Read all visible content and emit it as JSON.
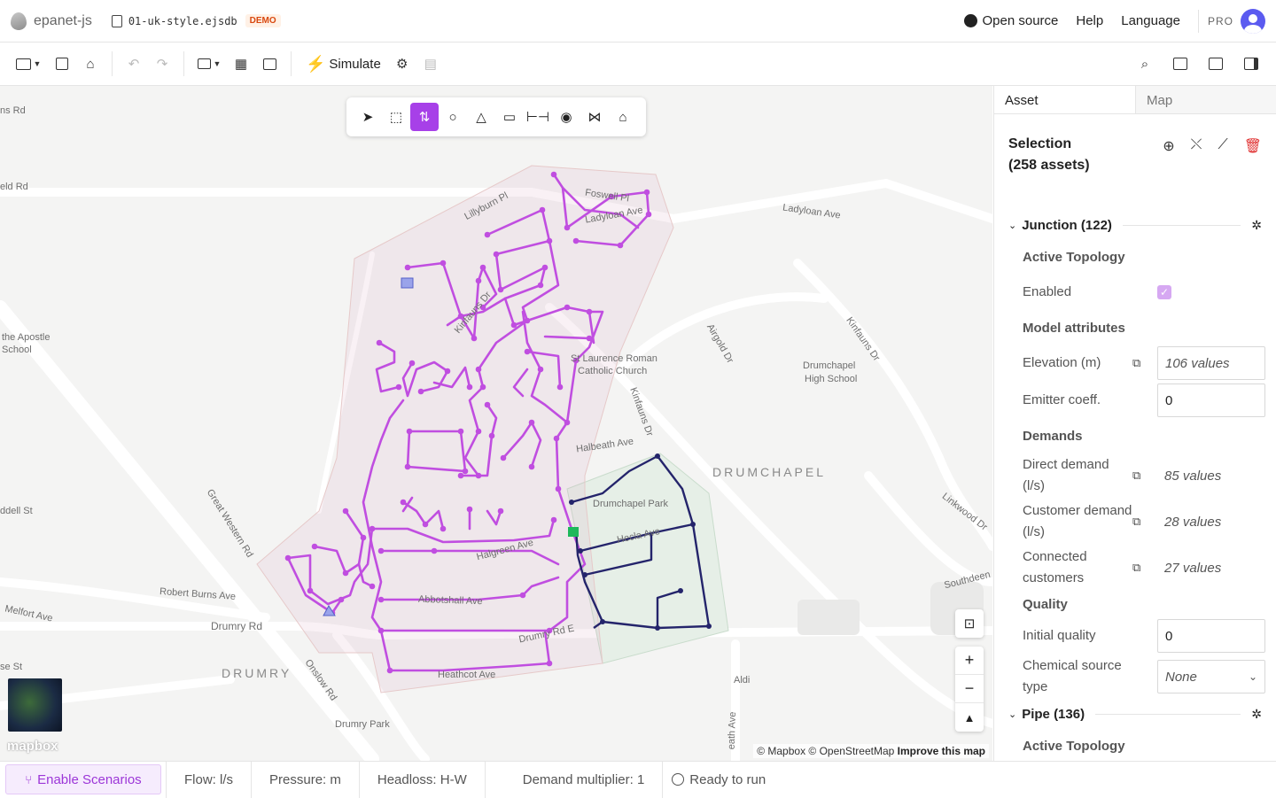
{
  "header": {
    "app_name": "epanet-js",
    "file_name": "01-uk-style.ejsdb",
    "demo_badge": "DEMO",
    "links": [
      "Open source",
      "Help",
      "Language"
    ],
    "pro_label": "PRO"
  },
  "toolbar": {
    "simulate_label": "Simulate",
    "icons": [
      "folder-icon",
      "save-icon",
      "save-as-icon",
      "undo-icon",
      "redo-icon",
      "import-icon",
      "table-icon",
      "map-view-icon",
      "simulate-icon",
      "settings-icon",
      "report-icon",
      "search-icon",
      "left-panel-icon",
      "bottom-panel-icon",
      "right-panel-icon"
    ]
  },
  "draw_tools": [
    "select-arrow-icon",
    "lasso-select-icon",
    "connect-tool-icon",
    "junction-tool-icon",
    "reservoir-tool-icon",
    "tank-tool-icon",
    "pipe-tool-icon",
    "pump-tool-icon",
    "valve-tool-icon",
    "customer-tool-icon"
  ],
  "map": {
    "labels": [
      "ns Rd",
      "eld Rd",
      "Lillyburn Pl",
      "Ladyloan Ave",
      "the Apostle",
      "School",
      "St Laurence Roman",
      "Catholic Church",
      "Airgold Dr",
      "Drumchapel",
      "High School",
      "Kinfauns Dr",
      "Kinfauns Dr",
      "Halbeath Ave",
      "Drumchapel Park",
      "Hecla Ave",
      "Halgreen Ave",
      "ddell St",
      "Great Western Rd",
      "Robert Burns Ave",
      "Melfort Ave",
      "Drumry Rd",
      "Abbotshall Ave",
      "Drumry Rd E",
      "Heathcot Ave",
      "Onslow Rd",
      "se St",
      "Drumry Park",
      "Aldi",
      "Linkwood Dr",
      "Southdeen",
      "eath Ave",
      "Foswell Pl",
      "Ladyloan Ave",
      "Kinfauns Dr"
    ],
    "areas": [
      "DRUMCHAPEL",
      "DRUMRY"
    ],
    "attribution": "© Mapbox © OpenStreetMap",
    "improve": "Improve this map",
    "mapbox_logo": "mapbox"
  },
  "panel": {
    "tabs": [
      "Asset",
      "Map"
    ],
    "selection_title": "Selection",
    "selection_count": "(258 assets)",
    "junction_section": "Junction (122)",
    "active_topology": "Active Topology",
    "enabled_label": "Enabled",
    "model_attributes": "Model attributes",
    "elevation_label": "Elevation (m)",
    "elevation_value": "106 values",
    "emitter_label": "Emitter coeff.",
    "emitter_value": "0",
    "demands_label": "Demands",
    "direct_demand_label": "Direct demand (l/s)",
    "direct_demand_value": "85 values",
    "customer_demand_label": "Customer demand (l/s)",
    "customer_demand_value": "28 values",
    "connected_label": "Connected customers",
    "connected_value": "27 values",
    "quality_label": "Quality",
    "initial_quality_label": "Initial quality",
    "initial_quality_value": "0",
    "chem_label": "Chemical source type",
    "chem_value": "None",
    "pipe_section": "Pipe (136)",
    "pipe_active_topology": "Active Topology"
  },
  "status": {
    "scenarios": "Enable Scenarios",
    "flow": "Flow: l/s",
    "pressure": "Pressure: m",
    "headloss": "Headloss: H-W",
    "demand": "Demand multiplier: 1",
    "run": "Ready to run"
  },
  "colors": {
    "accent": "#a740e8",
    "network": "#c04ee0",
    "network_zone2": "#24246b"
  }
}
